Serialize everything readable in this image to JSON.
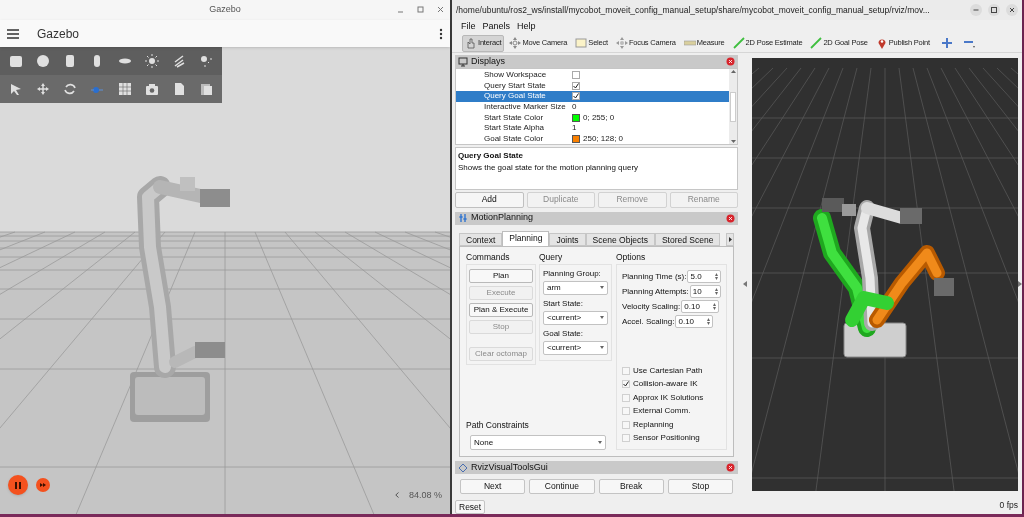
{
  "gazebo": {
    "window_title": "Gazebo",
    "app_title": "Gazebo",
    "zoom": "84.08 %"
  },
  "rviz": {
    "window_title": "/home/ubuntu/ros2_ws/install/mycobot_moveit_config_manual_setup/share/mycobot_moveit_config_manual_setup/rviz/mov...",
    "menu": [
      "File",
      "Panels",
      "Help"
    ],
    "tools": [
      {
        "label": "Interact",
        "selected": true
      },
      {
        "label": "Move Camera",
        "selected": false
      },
      {
        "label": "Select",
        "selected": false
      },
      {
        "label": "Focus Camera",
        "selected": false
      },
      {
        "label": "Measure",
        "selected": false
      },
      {
        "label": "2D Pose Estimate",
        "selected": false
      },
      {
        "label": "2D Goal Pose",
        "selected": false
      },
      {
        "label": "Publish Point",
        "selected": false
      }
    ],
    "displays": {
      "title": "Displays",
      "properties": [
        {
          "name": "Show Workspace",
          "kind": "checkbox",
          "checked": false,
          "selected": false
        },
        {
          "name": "Query Start State",
          "kind": "checkbox",
          "checked": true,
          "selected": false
        },
        {
          "name": "Query Goal State",
          "kind": "checkbox",
          "checked": true,
          "selected": true
        },
        {
          "name": "Interactive Marker Size",
          "kind": "text",
          "value": "0",
          "selected": false
        },
        {
          "name": "Start State Color",
          "kind": "color",
          "value": "0; 255; 0",
          "color": "#00ff00",
          "selected": false
        },
        {
          "name": "Start State Alpha",
          "kind": "text",
          "value": "1",
          "selected": false
        },
        {
          "name": "Goal State Color",
          "kind": "color",
          "value": "250; 128; 0",
          "color": "#fa8000",
          "selected": false
        }
      ],
      "description": {
        "title": "Query Goal State",
        "text": "Shows the goal state for the motion planning query"
      },
      "buttons": [
        {
          "label": "Add",
          "disabled": false
        },
        {
          "label": "Duplicate",
          "disabled": true
        },
        {
          "label": "Remove",
          "disabled": true
        },
        {
          "label": "Rename",
          "disabled": true
        }
      ]
    },
    "motion_planning": {
      "title": "MotionPlanning",
      "tabs": [
        {
          "label": "Context",
          "selected": false
        },
        {
          "label": "Planning",
          "selected": true
        },
        {
          "label": "Joints",
          "selected": false
        },
        {
          "label": "Scene Objects",
          "selected": false
        },
        {
          "label": "Stored Scene",
          "selected": false
        }
      ],
      "commands": {
        "label": "Commands",
        "buttons": [
          {
            "label": "Plan",
            "disabled": false
          },
          {
            "label": "Execute",
            "disabled": true
          },
          {
            "label": "Plan & Execute",
            "disabled": false
          },
          {
            "label": "Stop",
            "disabled": true
          },
          {
            "label": "Clear octomap",
            "disabled": true
          }
        ]
      },
      "query": {
        "label": "Query",
        "fields": [
          {
            "label": "Planning Group:",
            "value": "arm"
          },
          {
            "label": "Start State:",
            "value": "<current>"
          },
          {
            "label": "Goal State:",
            "value": "<current>"
          }
        ]
      },
      "options": {
        "label": "Options",
        "spinners": [
          {
            "label": "Planning Time (s):",
            "value": "5.0"
          },
          {
            "label": "Planning Attempts:",
            "value": "10"
          },
          {
            "label": "Velocity Scaling:",
            "value": "0.10"
          },
          {
            "label": "Accel. Scaling:",
            "value": "0.10"
          }
        ],
        "checkboxes": [
          {
            "label": "Use Cartesian Path",
            "checked": false
          },
          {
            "label": "Collision-aware IK",
            "checked": true
          },
          {
            "label": "Approx IK Solutions",
            "checked": false
          },
          {
            "label": "External Comm.",
            "checked": false
          },
          {
            "label": "Replanning",
            "checked": false
          },
          {
            "label": "Sensor Positioning",
            "checked": false
          }
        ]
      },
      "path_constraints": {
        "label": "Path Constraints",
        "value": "None"
      }
    },
    "visual_tools": {
      "title": "RvizVisualToolsGui",
      "buttons": [
        "Next",
        "Continue",
        "Break",
        "Stop"
      ]
    },
    "reset": "Reset",
    "fps": "0 fps"
  }
}
